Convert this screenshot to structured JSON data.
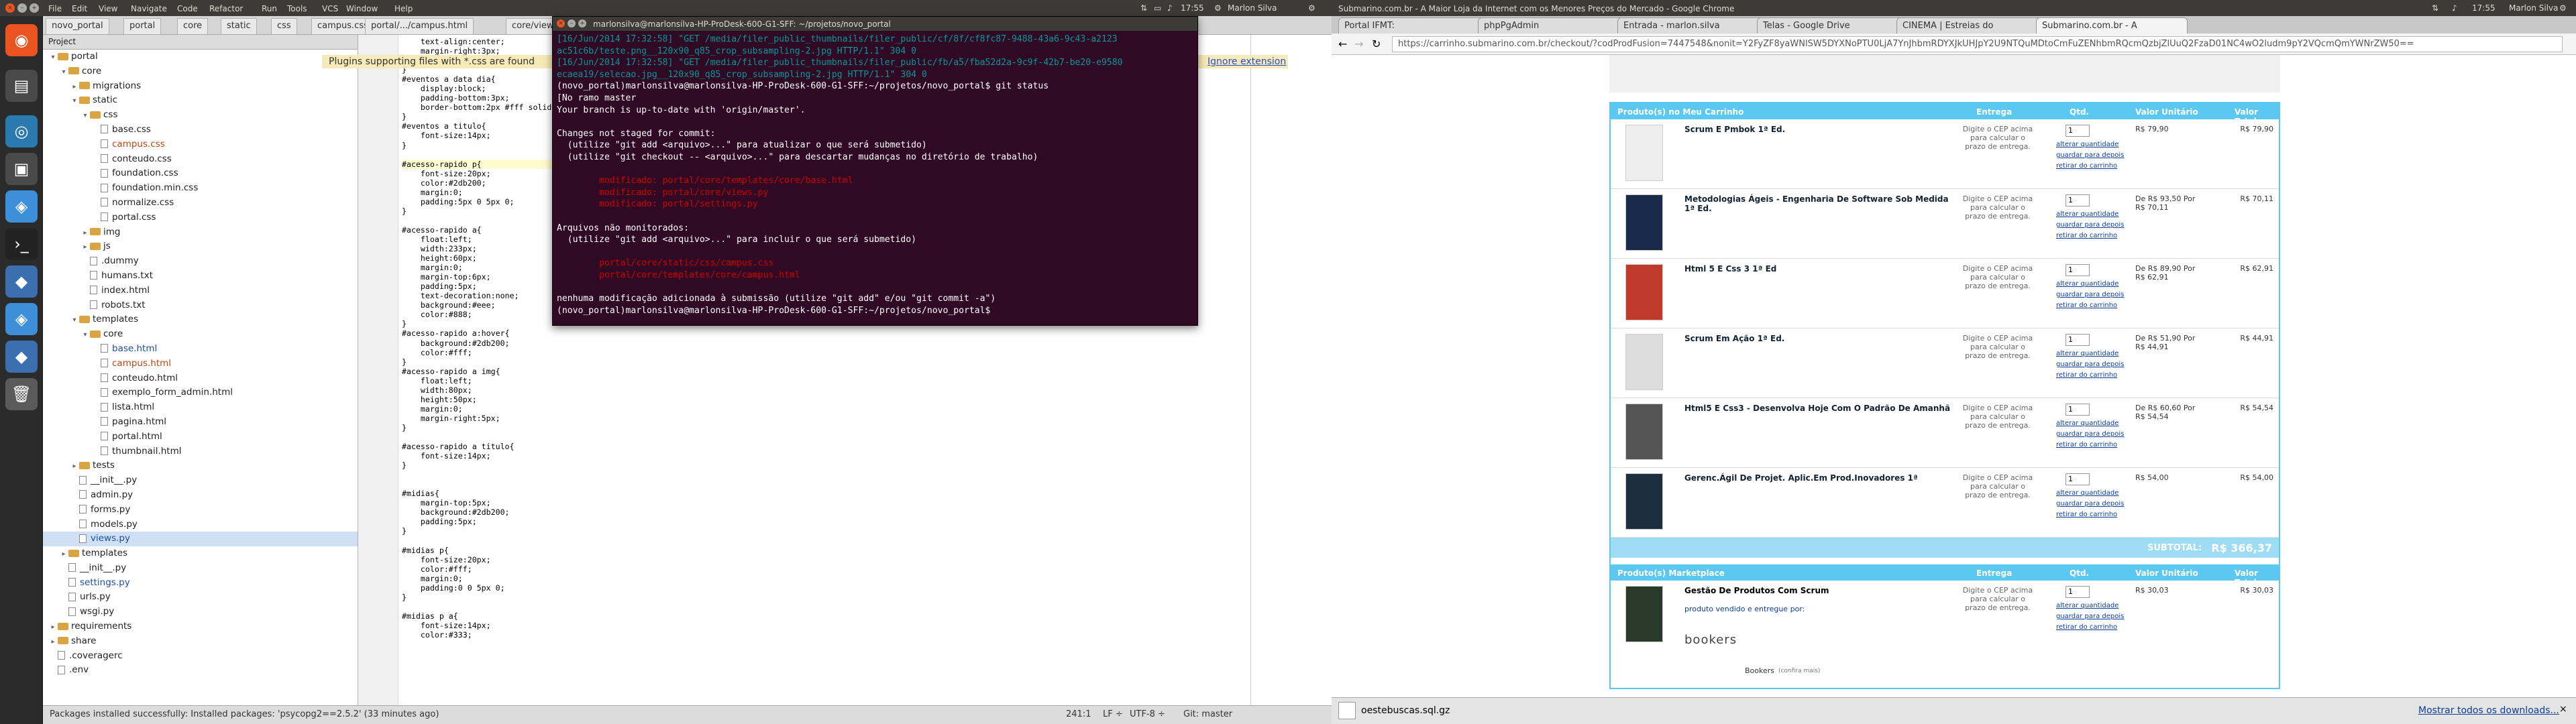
{
  "left_panel": {
    "app_menu": [
      "File",
      "Edit",
      "View",
      "Navigate",
      "Code",
      "Refactor",
      "Run",
      "Tools",
      "VCS",
      "Window",
      "Help"
    ],
    "tray_text": "Marlon Silva",
    "clock": "17:55"
  },
  "right_panel": {
    "title": "Submarino.com.br - A Maior Loja da Internet com os Menores Preços do Mercado - Google Chrome",
    "clock": "17:55",
    "user": "Marlon Silva"
  },
  "ide": {
    "tabs": [
      "novo_portal",
      "portal",
      "core",
      "static",
      "css",
      "campus.css",
      "portal/.../campus.html",
      "core/views.py"
    ],
    "project_header": "Project",
    "notice_text": "Plugins supporting files with *.css are found",
    "notice_link": "Ignore extension",
    "tree": [
      {
        "level": 0,
        "kind": "folder",
        "label": "portal",
        "open": true
      },
      {
        "level": 1,
        "kind": "folder",
        "label": "core",
        "open": true
      },
      {
        "level": 2,
        "kind": "folder",
        "label": "migrations",
        "open": false
      },
      {
        "level": 2,
        "kind": "folder",
        "label": "static",
        "open": true
      },
      {
        "level": 3,
        "kind": "folder",
        "label": "css",
        "open": true
      },
      {
        "level": 4,
        "kind": "file",
        "label": "base.css"
      },
      {
        "level": 4,
        "kind": "file",
        "label": "campus.css",
        "color": "#c1440e"
      },
      {
        "level": 4,
        "kind": "file",
        "label": "conteudo.css"
      },
      {
        "level": 4,
        "kind": "file",
        "label": "foundation.css"
      },
      {
        "level": 4,
        "kind": "file",
        "label": "foundation.min.css"
      },
      {
        "level": 4,
        "kind": "file",
        "label": "normalize.css"
      },
      {
        "level": 4,
        "kind": "file",
        "label": "portal.css"
      },
      {
        "level": 3,
        "kind": "folder",
        "label": "img",
        "open": false
      },
      {
        "level": 3,
        "kind": "folder",
        "label": "js",
        "open": false
      },
      {
        "level": 3,
        "kind": "file",
        "label": ".dummy"
      },
      {
        "level": 3,
        "kind": "file",
        "label": "humans.txt"
      },
      {
        "level": 3,
        "kind": "file",
        "label": "index.html"
      },
      {
        "level": 3,
        "kind": "file",
        "label": "robots.txt"
      },
      {
        "level": 2,
        "kind": "folder",
        "label": "templates",
        "open": true
      },
      {
        "level": 3,
        "kind": "folder",
        "label": "core",
        "open": true
      },
      {
        "level": 4,
        "kind": "file",
        "label": "base.html",
        "color": "#1a4fa0"
      },
      {
        "level": 4,
        "kind": "file",
        "label": "campus.html",
        "color": "#c1440e"
      },
      {
        "level": 4,
        "kind": "file",
        "label": "conteudo.html"
      },
      {
        "level": 4,
        "kind": "file",
        "label": "exemplo_form_admin.html"
      },
      {
        "level": 4,
        "kind": "file",
        "label": "lista.html"
      },
      {
        "level": 4,
        "kind": "file",
        "label": "pagina.html"
      },
      {
        "level": 4,
        "kind": "file",
        "label": "portal.html"
      },
      {
        "level": 4,
        "kind": "file",
        "label": "thumbnail.html"
      },
      {
        "level": 2,
        "kind": "folder",
        "label": "tests",
        "open": false
      },
      {
        "level": 2,
        "kind": "file",
        "label": "__init__.py"
      },
      {
        "level": 2,
        "kind": "file",
        "label": "admin.py"
      },
      {
        "level": 2,
        "kind": "file",
        "label": "forms.py"
      },
      {
        "level": 2,
        "kind": "file",
        "label": "models.py"
      },
      {
        "level": 2,
        "kind": "file",
        "label": "views.py",
        "color": "#1a4fa0",
        "selected": true
      },
      {
        "level": 1,
        "kind": "folder",
        "label": "templates",
        "open": false
      },
      {
        "level": 1,
        "kind": "file",
        "label": "__init__.py"
      },
      {
        "level": 1,
        "kind": "file",
        "label": "settings.py",
        "color": "#1a4fa0"
      },
      {
        "level": 1,
        "kind": "file",
        "label": "urls.py"
      },
      {
        "level": 1,
        "kind": "file",
        "label": "wsgi.py"
      },
      {
        "level": 0,
        "kind": "folder",
        "label": "requirements",
        "open": false
      },
      {
        "level": 0,
        "kind": "folder",
        "label": "share",
        "open": false
      },
      {
        "level": 0,
        "kind": "file",
        "label": ".coveragerc"
      },
      {
        "level": 0,
        "kind": "file",
        "label": ".env"
      }
    ],
    "code_lines": [
      "    text-align:center;",
      "    margin-right:3px;",
      "    color:#fff;",
      "}",
      "#eventos a data dia{",
      "    display:block;",
      "    padding-bottom:3px;",
      "    border-bottom:2px #fff solid;",
      "}",
      "#eventos a titulo{",
      "    font-size:14px;",
      "}",
      "",
      "#acesso-rapido p{",
      "    font-size:20px;",
      "    color:#2db200;",
      "    margin:0;",
      "    padding:5px 0 5px 0;",
      "}",
      "",
      "#acesso-rapido a{",
      "    float:left;",
      "    width:233px;",
      "    height:60px;",
      "    margin:0;",
      "    margin-top:6px;",
      "    padding:5px;",
      "    text-decoration:none;",
      "    background:#eee;",
      "    color:#888;",
      "}",
      "#acesso-rapido a:hover{",
      "    background:#2db200;",
      "    color:#fff;",
      "}",
      "#acesso-rapido a img{",
      "    float:left;",
      "    width:80px;",
      "    height:50px;",
      "    margin:0;",
      "    margin-right:5px;",
      "}",
      "",
      "#acesso-rapido a titulo{",
      "    font-size:14px;",
      "}",
      "",
      "",
      "#midias{",
      "    margin-top:5px;",
      "    background:#2db200;",
      "    padding:5px;",
      "}",
      "",
      "#midias p{",
      "    font-size:20px;",
      "    color:#fff;",
      "    margin:0;",
      "    padding:0 0 5px 0;",
      "}",
      "",
      "#midias p a{",
      "    font-size:14px;",
      "    color:#333;"
    ],
    "status_text": "Packages installed successfully: Installed packages: 'psycopg2==2.5.2' (33 minutes ago)",
    "status_pos": "241:1",
    "status_lf": "LF ÷",
    "status_enc": "UTF-8 ÷",
    "status_git": "Git: master"
  },
  "terminal": {
    "title": "marlonsilva@marlonsilva-HP-ProDesk-600-G1-SFF: ~/projetos/novo_portal",
    "lines": [
      {
        "t": "[16/Jun/2014 17:32:58] \"GET /media/filer_public_thumbnails/filer_public/cf/8f/cf8fc87-9488-43a6-9c43-a2123",
        "c": "c"
      },
      {
        "t": "ac51c6b/teste.png__120x90_q85_crop_subsampling-2.jpg HTTP/1.1\" 304 0",
        "c": "c"
      },
      {
        "t": "[16/Jun/2014 17:32:58] \"GET /media/filer_public_thumbnails/filer_public/fb/a5/fba52d2a-9c9f-42b7-be20-e9580",
        "c": "c"
      },
      {
        "t": "ecaea19/selecao.jpg__120x90_q85_crop_subsampling-2.jpg HTTP/1.1\" 304 0",
        "c": "c"
      },
      {
        "t": "(novo_portal)marlonsilva@marlonsilva-HP-ProDesk-600-G1-SFF:~/projetos/novo_portal$ git status",
        "c": ""
      },
      {
        "t": "[No ramo master",
        "c": ""
      },
      {
        "t": "Your branch is up-to-date with 'origin/master'.",
        "c": ""
      },
      {
        "t": "",
        "c": ""
      },
      {
        "t": "Changes not staged for commit:",
        "c": ""
      },
      {
        "t": "  (utilize \"git add <arquivo>...\" para atualizar o que será submetido)",
        "c": ""
      },
      {
        "t": "  (utilize \"git checkout -- <arquivo>...\" para descartar mudanças no diretório de trabalho)",
        "c": ""
      },
      {
        "t": "",
        "c": ""
      },
      {
        "t": "        modificado: portal/core/templates/core/base.html",
        "c": "r"
      },
      {
        "t": "        modificado: portal/core/views.py",
        "c": "r"
      },
      {
        "t": "        modificado: portal/settings.py",
        "c": "r"
      },
      {
        "t": "",
        "c": ""
      },
      {
        "t": "Arquivos não monitorados:",
        "c": ""
      },
      {
        "t": "  (utilize \"git add <arquivo>...\" para incluir o que será submetido)",
        "c": ""
      },
      {
        "t": "",
        "c": ""
      },
      {
        "t": "        portal/core/static/css/campus.css",
        "c": "r"
      },
      {
        "t": "        portal/core/templates/core/campus.html",
        "c": "r"
      },
      {
        "t": "",
        "c": ""
      },
      {
        "t": "nenhuma modificação adicionada à submissão (utilize \"git add\" e/ou \"git commit -a\")",
        "c": ""
      },
      {
        "t": "(novo_portal)marlonsilva@marlonsilva-HP-ProDesk-600-G1-SFF:~/projetos/novo_portal$ ",
        "c": ""
      }
    ]
  },
  "chrome": {
    "tabs": [
      "Portal IFMT:",
      "phpPgAdmin",
      "Entrada - marlon.silva",
      "Telas - Google Drive",
      "CINEMA | Estreias do",
      "Submarino.com.br - A"
    ],
    "url": "https://carrinho.submarino.com.br/checkout/?codProdFusion=7447548&nonit=Y2FyZF8yaWNlSW5DYXNoPTU0LjA7YnJhbmRDYXJkUHJpY2U9NTQuMDtoCmFuZENhbmRQcmQzbjZlUuQ2FzaD01NC4wO2ludm9pY2VQcmQmYWNrZW50==",
    "cart_headers": {
      "product": "Produto(s) no Meu Carrinho",
      "delivery": "Entrega",
      "qty": "Qtd.",
      "unit": "Valor Unitário",
      "total": "Valor Total"
    },
    "items": [
      {
        "name": "Scrum E Pmbok 1ª Ed.",
        "delivery": "Digite o CEP acima para calcular o prazo de entrega.",
        "qty": "1",
        "unit": "R$ 79,90",
        "total": "R$ 79,90"
      },
      {
        "name": "Metodologias Ágeis - Engenharia De Software Sob Medida 1ª Ed.",
        "delivery": "Digite o CEP acima para calcular o prazo de entrega.",
        "qty": "1",
        "unit": "De R$ 93,50 Por R$ 70,11",
        "total": "R$ 70,11"
      },
      {
        "name": "Html 5 E Css 3 1ª Ed",
        "delivery": "Digite o CEP acima para calcular o prazo de entrega.",
        "qty": "1",
        "unit": "De R$ 89,90 Por R$ 62,91",
        "total": "R$ 62,91"
      },
      {
        "name": "Scrum Em Ação 1ª Ed.",
        "delivery": "Digite o CEP acima para calcular o prazo de entrega.",
        "qty": "1",
        "unit": "De R$ 51,90 Por R$ 44,91",
        "total": "R$ 44,91"
      },
      {
        "name": "Html5 E Css3 - Desenvolva Hoje Com O Padrão De Amanhã",
        "delivery": "Digite o CEP acima para calcular o prazo de entrega.",
        "qty": "1",
        "unit": "De R$ 60,60 Por R$ 54,54",
        "total": "R$ 54,54"
      },
      {
        "name": "Gerenc.Ágil De Projet. Aplic.Em Prod.Inovadores 1ª",
        "delivery": "Digite o CEP acima para calcular o prazo de entrega.",
        "qty": "1",
        "unit": "R$ 54,00",
        "total": "R$ 54,00"
      }
    ],
    "links": [
      "alterar quantidade",
      "guardar para depois",
      "retirar do carrinho"
    ],
    "subtotal_label": "SUBTOTAL:",
    "subtotal_value": "R$ 366,37",
    "market_headers": {
      "product": "Produto(s) Marketplace",
      "delivery": "Entrega",
      "qty": "Qtd.",
      "unit": "Valor Unitário",
      "total": "Valor Total"
    },
    "market_item": {
      "name": "Gestão De Produtos Com Scrum",
      "delivery": "Digite o CEP acima para calcular o prazo de entrega.",
      "qty": "1",
      "unit": "R$ 30,03",
      "total": "R$ 30,03",
      "seller_note": "produto vendido e entregue por:",
      "seller_logo": "bookers",
      "seller": "Bookers",
      "seller_rating": "(confira mais)"
    },
    "download_file": "oestebuscas.sql.gz",
    "download_all": "Mostrar todos os downloads..."
  },
  "colors": {
    "terminal_bg": "#300a24",
    "cart_accent": "#5ac8f0",
    "orange": "#e95420"
  }
}
